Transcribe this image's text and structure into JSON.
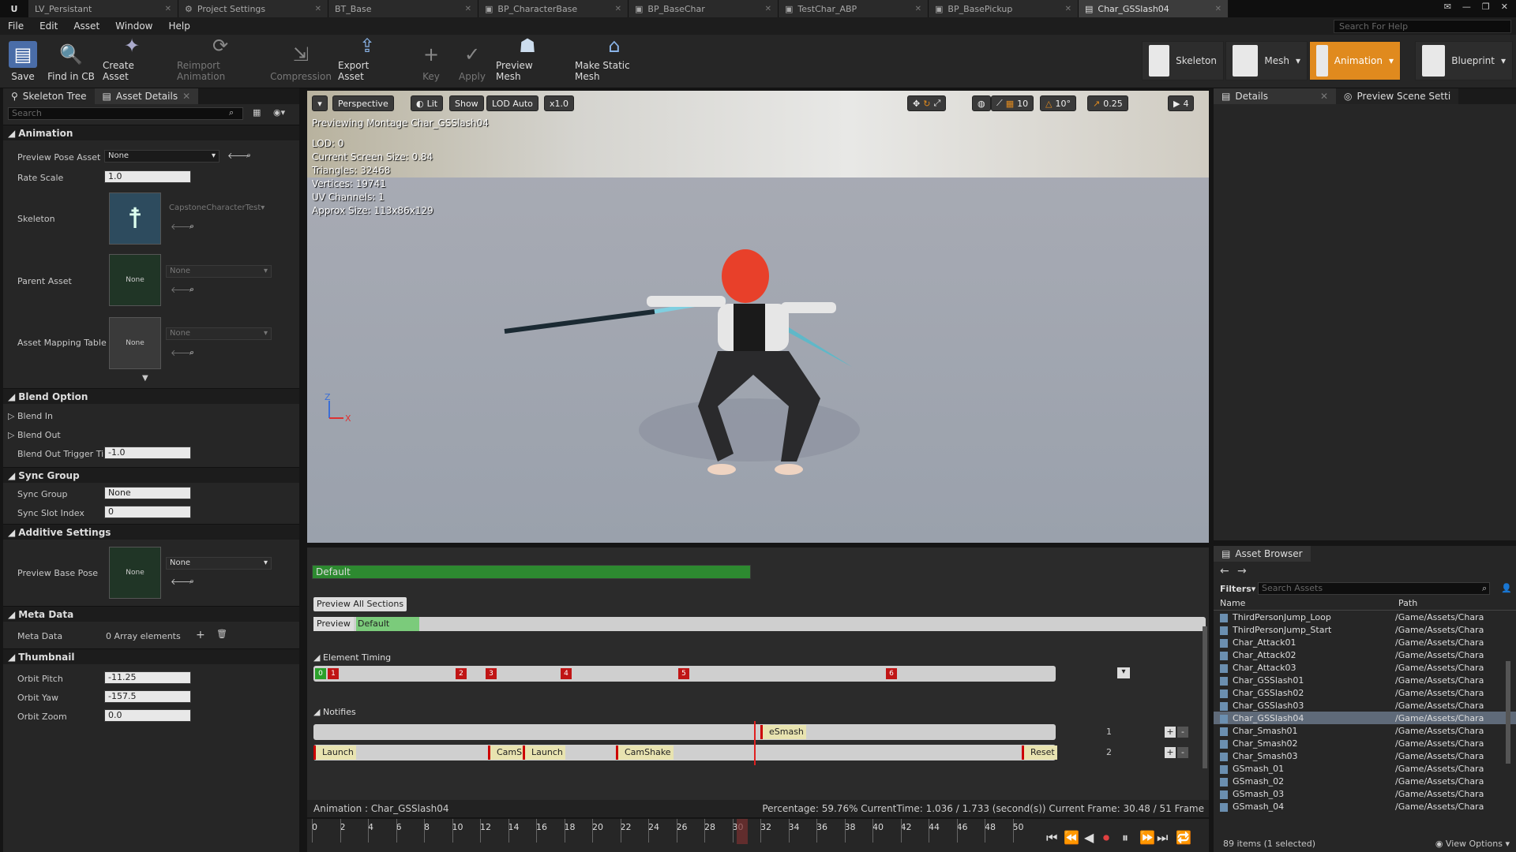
{
  "tabs": [
    "LV_Persistant",
    "Project Settings",
    "BT_Base",
    "BP_CharacterBase",
    "BP_BaseChar",
    "TestChar_ABP",
    "BP_BasePickup",
    "Char_GSSlash04"
  ],
  "menu": [
    "File",
    "Edit",
    "Asset",
    "Window",
    "Help"
  ],
  "help_search": "Search For Help",
  "toolbar": {
    "save": "Save",
    "find": "Find in CB",
    "create": "Create Asset",
    "reimport": "Reimport Animation",
    "compression": "Compression",
    "export": "Export Asset",
    "key": "Key",
    "apply": "Apply",
    "preview_mesh": "Preview Mesh",
    "make_static": "Make Static Mesh"
  },
  "modes": {
    "skeleton": "Skeleton",
    "mesh": "Mesh",
    "animation": "Animation",
    "blueprint": "Blueprint"
  },
  "left": {
    "tab1": "Skeleton Tree",
    "tab2": "Asset Details",
    "search": "Search",
    "animation": "Animation",
    "preview_pose": "Preview Pose Asset",
    "preview_pose_val": "None",
    "rate_scale": "Rate Scale",
    "rate_scale_val": "1.0",
    "skeleton": "Skeleton",
    "skeleton_val": "CapstoneCharacterTest",
    "parent_asset": "Parent Asset",
    "none": "None",
    "asset_mapping": "Asset Mapping Table",
    "blend_option": "Blend Option",
    "blend_in": "Blend In",
    "blend_out": "Blend Out",
    "blend_out_trigger": "Blend Out Trigger Tin",
    "blend_out_trigger_val": "-1.0",
    "sync_group": "Sync Group",
    "sync_group_label": "Sync Group",
    "sync_group_val": "None",
    "sync_slot": "Sync Slot Index",
    "sync_slot_val": "0",
    "additive": "Additive Settings",
    "preview_base": "Preview Base Pose",
    "meta": "Meta Data",
    "meta_label": "Meta Data",
    "meta_val": "0 Array elements",
    "thumbnail": "Thumbnail",
    "orbit_pitch": "Orbit Pitch",
    "orbit_pitch_val": "-11.25",
    "orbit_yaw": "Orbit Yaw",
    "orbit_yaw_val": "-157.5",
    "orbit_zoom": "Orbit Zoom",
    "orbit_zoom_val": "0.0"
  },
  "viewport": {
    "perspective": "Perspective",
    "lit": "Lit",
    "show": "Show",
    "lod": "LOD Auto",
    "speed": "x1.0",
    "grid": "10",
    "angle": "10°",
    "scale": "0.25",
    "cam": "4",
    "previewing": "Previewing Montage Char_GSSlash04",
    "stats": [
      "LOD: 0",
      "Current Screen Size: 0.84",
      "Triangles: 32468",
      "Vertices: 19741",
      "UV Channels: 1",
      "Approx Size: 113x86x129"
    ]
  },
  "montage": {
    "section": "Default",
    "preview_all": "Preview All Sections",
    "preview": "Preview",
    "preview_default": "Default",
    "element_timing": "Element Timing",
    "notifies": "Notifies",
    "timing_markers": [
      "0",
      "1",
      "2",
      "3",
      "4",
      "5",
      "6"
    ],
    "notifies_row1": [
      "eSmash"
    ],
    "notifies_row2": [
      "Launch",
      "CamSh",
      "Launch",
      "CamShake",
      "Reset"
    ],
    "track_num1": "2",
    "track_num2": "1"
  },
  "status": {
    "animation": "Animation : Char_GSSlash04",
    "percentage": "Percentage: 59.76% CurrentTime: 1.036 / 1.733 (second(s)) Current Frame: 30.48 / 51 Frame"
  },
  "timeline": {
    "ticks": [
      "0",
      "2",
      "4",
      "6",
      "8",
      "10",
      "12",
      "14",
      "16",
      "18",
      "20",
      "22",
      "24",
      "26",
      "28",
      "30",
      "32",
      "34",
      "36",
      "38",
      "40",
      "42",
      "44",
      "46",
      "48",
      "50"
    ]
  },
  "right": {
    "details": "Details",
    "preview_scene": "Preview Scene Setti",
    "asset_browser": "Asset Browser",
    "filters": "Filters",
    "search_assets": "Search Assets",
    "col_name": "Name",
    "col_path": "Path",
    "count": "89 items (1 selected)",
    "view_options": "View Options",
    "assets": [
      [
        "ThirdPersonJump_Loop",
        "/Game/Assets/Chara"
      ],
      [
        "ThirdPersonJump_Start",
        "/Game/Assets/Chara"
      ],
      [
        "Char_Attack01",
        "/Game/Assets/Chara"
      ],
      [
        "Char_Attack02",
        "/Game/Assets/Chara"
      ],
      [
        "Char_Attack03",
        "/Game/Assets/Chara"
      ],
      [
        "Char_GSSlash01",
        "/Game/Assets/Chara"
      ],
      [
        "Char_GSSlash02",
        "/Game/Assets/Chara"
      ],
      [
        "Char_GSSlash03",
        "/Game/Assets/Chara"
      ],
      [
        "Char_GSSlash04",
        "/Game/Assets/Chara"
      ],
      [
        "Char_Smash01",
        "/Game/Assets/Chara"
      ],
      [
        "Char_Smash02",
        "/Game/Assets/Chara"
      ],
      [
        "Char_Smash03",
        "/Game/Assets/Chara"
      ],
      [
        "GSmash_01",
        "/Game/Assets/Chara"
      ],
      [
        "GSmash_02",
        "/Game/Assets/Chara"
      ],
      [
        "GSmash_03",
        "/Game/Assets/Chara"
      ],
      [
        "GSmash_04",
        "/Game/Assets/Chara"
      ]
    ]
  }
}
